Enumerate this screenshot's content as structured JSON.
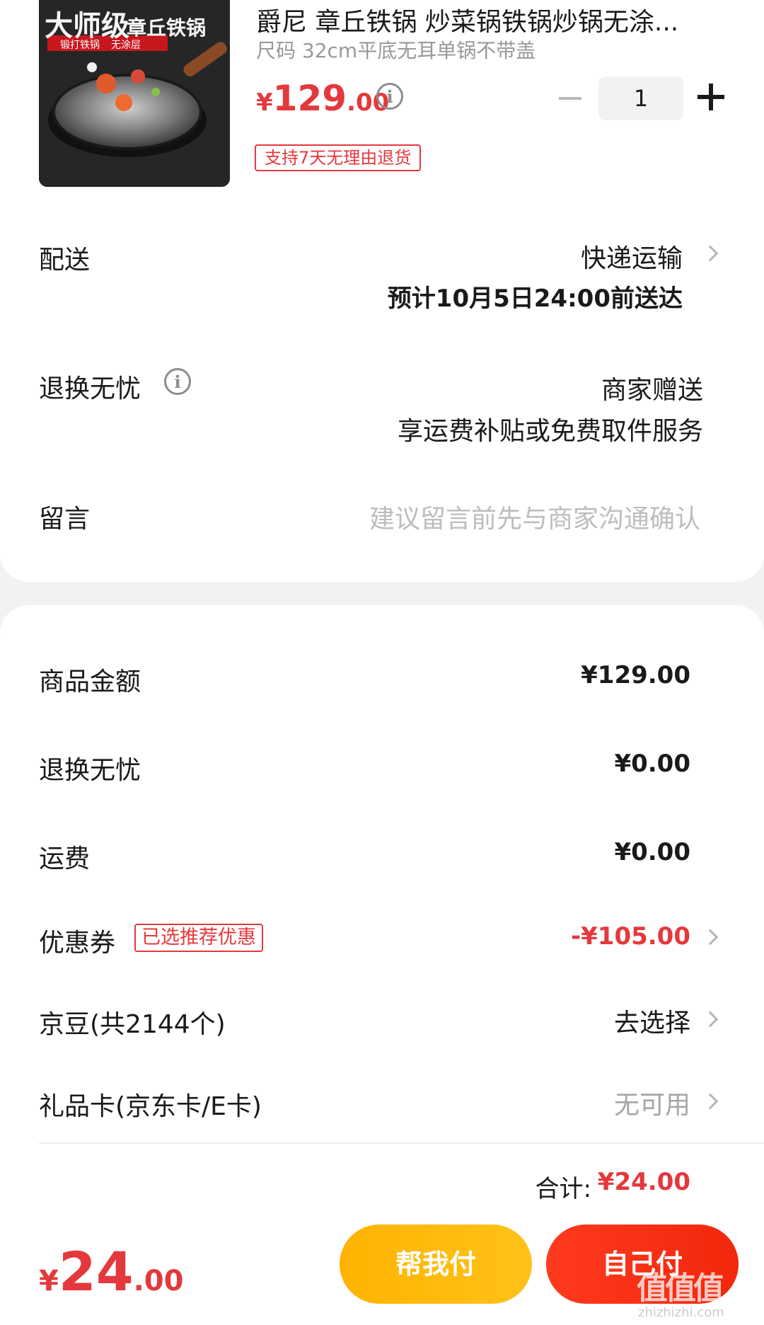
{
  "product": {
    "title": "爵尼 章丘铁锅 炒菜锅铁锅炒锅无涂...",
    "spec": "尺码 32cm平底无耳单锅不带盖",
    "price_currency": "¥",
    "price_int": "129",
    "price_dec": ".00",
    "quantity": "1",
    "return_tag": "支持7天无理由退货",
    "image": {
      "brand_text": "大师级",
      "sub_text": "章丘铁锅",
      "tag1": "锻打铁锅",
      "tag2": "无涂层"
    }
  },
  "delivery": {
    "label": "配送",
    "method": "快递运输",
    "eta": "预计10月5日24:00前送达"
  },
  "return_service": {
    "label": "退换无忧",
    "value": "商家赠送",
    "desc": "享运费补贴或免费取件服务"
  },
  "message": {
    "label": "留言",
    "placeholder": "建议留言前先与商家沟通确认"
  },
  "summary": {
    "goods_label": "商品金额",
    "goods_value": "¥129.00",
    "return_label": "退换无忧",
    "return_value": "¥0.00",
    "shipping_label": "运费",
    "shipping_value": "¥0.00",
    "coupon_label": "优惠券",
    "coupon_tag": "已选推荐优惠",
    "coupon_value": "-¥105.00",
    "jingdou_label": "京豆(共2144个)",
    "jingdou_value": "去选择",
    "giftcard_label": "礼品卡(京东卡/E卡)",
    "giftcard_value": "无可用",
    "total_label": "合计:",
    "total_value": "¥24.00"
  },
  "bottom": {
    "currency": "¥",
    "total_int": "24",
    "total_dec": ".00",
    "help_pay": "帮我付",
    "self_pay": "自己付"
  },
  "watermark": {
    "text": "值值值",
    "url": "zhizhizhi.com"
  },
  "colors": {
    "accent_red": "#e4393c",
    "help_button": "#ffb300",
    "self_button": "#f2270c"
  }
}
